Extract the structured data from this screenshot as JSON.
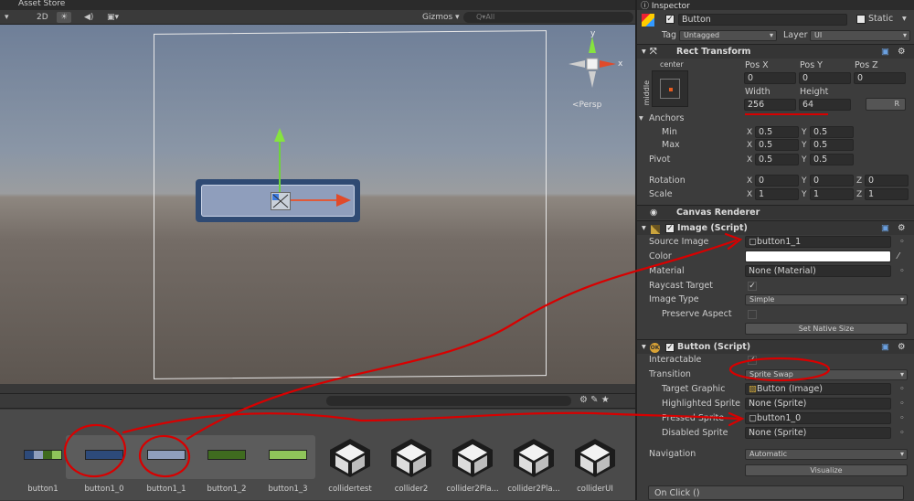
{
  "window": {
    "asset_store_tab": "Asset Store",
    "inspector_tab": "Inspector"
  },
  "scene_toolbar": {
    "mode_2d": "2D",
    "gizmos": "Gizmos",
    "search_placeholder": "Q▾All"
  },
  "scene": {
    "persp_label": "<Persp",
    "axis_labels": {
      "y": "y",
      "x": "x"
    }
  },
  "assets": [
    {
      "name": "button1",
      "kind": "sprite"
    },
    {
      "name": "button1_0",
      "kind": "sprite",
      "color": "#2d4a7a"
    },
    {
      "name": "button1_1",
      "kind": "sprite",
      "color": "#8f9ebc"
    },
    {
      "name": "button1_2",
      "kind": "sprite",
      "color": "#3f6b1f"
    },
    {
      "name": "button1_3",
      "kind": "sprite",
      "color": "#8fc45a"
    },
    {
      "name": "collidertest",
      "kind": "unity"
    },
    {
      "name": "collider2",
      "kind": "unity"
    },
    {
      "name": "collider2Pla...",
      "kind": "unity"
    },
    {
      "name": "collider2Pla...",
      "kind": "unity"
    },
    {
      "name": "colliderUI",
      "kind": "unity"
    }
  ],
  "inspector": {
    "object_name": "Button",
    "static_label": "Static",
    "tag_label": "Tag",
    "tag_value": "Untagged",
    "layer_label": "Layer",
    "layer_value": "UI",
    "rect_transform": {
      "title": "Rect Transform",
      "anchor_preset": {
        "horizontal": "center",
        "vertical": "middle"
      },
      "pos_x_label": "Pos X",
      "pos_y_label": "Pos Y",
      "pos_z_label": "Pos Z",
      "pos_x": "0",
      "pos_y": "0",
      "pos_z": "0",
      "width_label": "Width",
      "height_label": "Height",
      "width": "256",
      "height": "64",
      "r_button": "R",
      "anchors_label": "Anchors",
      "min_label": "Min",
      "max_label": "Max",
      "pivot_label": "Pivot",
      "min_x": "0.5",
      "min_y": "0.5",
      "max_x": "0.5",
      "max_y": "0.5",
      "pivot_x": "0.5",
      "pivot_y": "0.5",
      "rotation_label": "Rotation",
      "scale_label": "Scale",
      "rot_x": "0",
      "rot_y": "0",
      "rot_z": "0",
      "scale_x": "1",
      "scale_y": "1",
      "scale_z": "1",
      "axis_x": "X",
      "axis_y": "Y",
      "axis_z": "Z"
    },
    "canvas_renderer": {
      "title": "Canvas Renderer"
    },
    "image_script": {
      "title": "Image (Script)",
      "source_image_label": "Source Image",
      "source_image": "button1_1",
      "color_label": "Color",
      "material_label": "Material",
      "material": "None (Material)",
      "raycast_label": "Raycast Target",
      "image_type_label": "Image Type",
      "image_type": "Simple",
      "preserve_label": "Preserve Aspect",
      "native_size_button": "Set Native Size"
    },
    "button_script": {
      "title": "Button (Script)",
      "interactable_label": "Interactable",
      "transition_label": "Transition",
      "transition": "Sprite Swap",
      "target_graphic_label": "Target Graphic",
      "target_graphic": "Button (Image)",
      "highlighted_label": "Highlighted Sprite",
      "highlighted": "None (Sprite)",
      "pressed_label": "Pressed Sprite",
      "pressed": "button1_0",
      "disabled_label": "Disabled Sprite",
      "disabled": "None (Sprite)",
      "navigation_label": "Navigation",
      "navigation": "Automatic",
      "visualize_button": "Visualize",
      "on_click_label": "On Click ()"
    }
  },
  "colors": {
    "annotation_red": "#d80000",
    "inspector_bg": "#3c3c3c",
    "sky": "#7d8ba2",
    "ground": "#6a625b"
  }
}
